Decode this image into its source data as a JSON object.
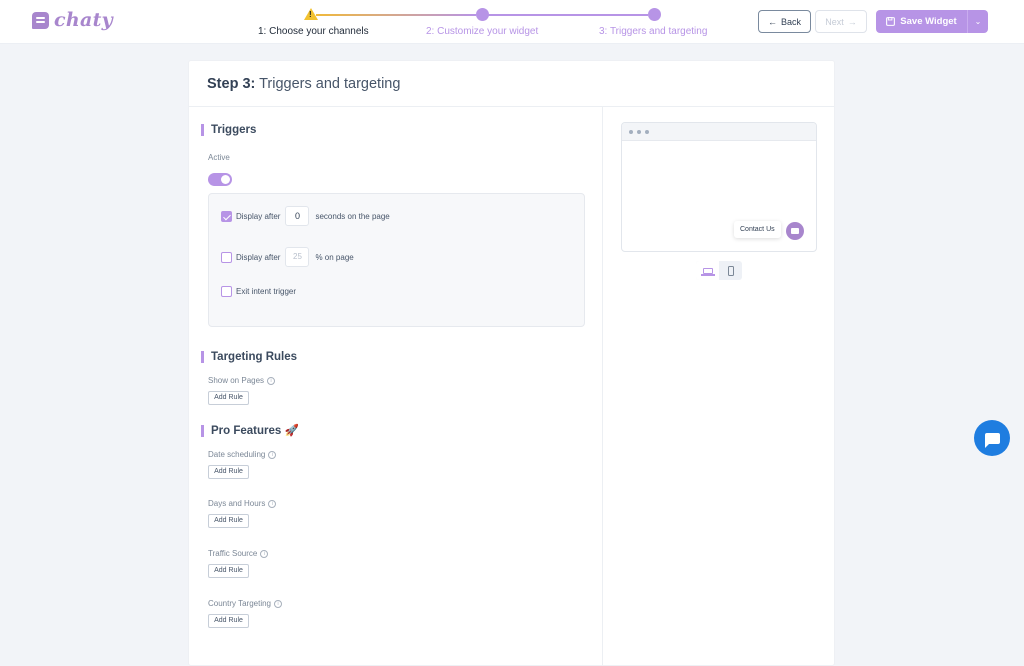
{
  "header": {
    "logo_text": "chaty",
    "steps": [
      {
        "label": "1: Choose your channels",
        "icon": "warning-icon"
      },
      {
        "label": "2: Customize your widget"
      },
      {
        "label": "3: Triggers and targeting"
      }
    ],
    "back_label": "Back",
    "next_label": "Next",
    "save_label": "Save Widget",
    "accent_color": "#b794e6"
  },
  "card": {
    "title_bold": "Step 3:",
    "title_rest": " Triggers and targeting"
  },
  "triggers": {
    "title": "Triggers",
    "active_label": "Active",
    "active": true,
    "rows": [
      {
        "checked": true,
        "before": "Display after",
        "value": "0",
        "after": "seconds on the page"
      },
      {
        "checked": false,
        "before": "Display after",
        "value": "25",
        "after": "% on page"
      },
      {
        "checked": false,
        "label": "Exit intent trigger"
      }
    ]
  },
  "targeting": {
    "title": "Targeting Rules",
    "show_on_pages": "Show on Pages",
    "add_rule": "Add Rule"
  },
  "pro": {
    "title": "Pro Features",
    "emoji": "🚀",
    "items": [
      {
        "label": "Date scheduling",
        "button": "Add Rule"
      },
      {
        "label": "Days and Hours",
        "button": "Add Rule"
      },
      {
        "label": "Traffic Source",
        "button": "Add Rule"
      },
      {
        "label": "Country Targeting",
        "button": "Add Rule"
      }
    ]
  },
  "preview": {
    "contact_label": "Contact Us",
    "widget_color": "#a886cd"
  },
  "float_chat_color": "#1f7de0"
}
